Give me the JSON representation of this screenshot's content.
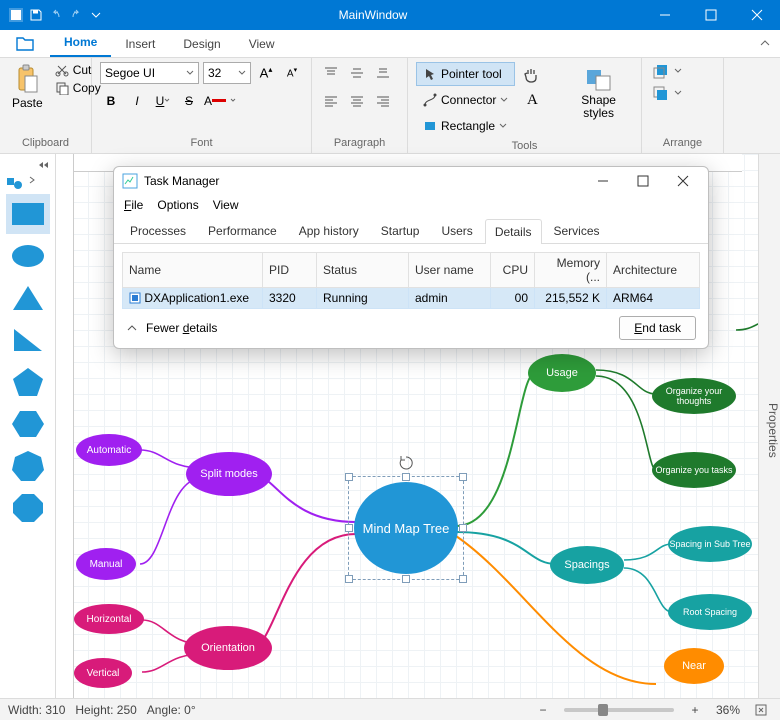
{
  "window": {
    "title": "MainWindow"
  },
  "ribbon": {
    "tabs": [
      "Home",
      "Insert",
      "Design",
      "View"
    ],
    "activeTab": 0,
    "clipboard": {
      "paste": "Paste",
      "cut": "Cut",
      "copy": "Copy",
      "label": "Clipboard"
    },
    "font": {
      "family": "Segoe UI",
      "size": "32",
      "label": "Font"
    },
    "paragraph": {
      "label": "Paragraph"
    },
    "tools": {
      "pointer": "Pointer tool",
      "connector": "Connector",
      "rectangle": "Rectangle",
      "shapeStyles": "Shape styles",
      "label": "Tools"
    },
    "arrange": {
      "label": "Arrange"
    }
  },
  "properties_label": "Properties",
  "status": {
    "width_label": "Width:",
    "width": "310",
    "height_label": "Height:",
    "height": "250",
    "angle_label": "Angle:",
    "angle": "0°",
    "zoom": "36%"
  },
  "mindmap": {
    "center": "Mind Map Tree",
    "usage": "Usage",
    "usage_c1": "Organize your thoughts",
    "usage_c2": "Organize you tasks",
    "spacings": "Spacings",
    "sp_c1": "Spacing in Sub Tree",
    "sp_c2": "Root Spacing",
    "near": "Near",
    "split": "Split modes",
    "auto": "Automatic",
    "manual": "Manual",
    "orientation": "Orientation",
    "horiz": "Horizontal",
    "vert": "Vertical"
  },
  "taskmgr": {
    "title": "Task Manager",
    "menu": {
      "file": "File",
      "options": "Options",
      "view": "View"
    },
    "tabs": [
      "Processes",
      "Performance",
      "App history",
      "Startup",
      "Users",
      "Details",
      "Services"
    ],
    "activeTab": 5,
    "columns": [
      "Name",
      "PID",
      "Status",
      "User name",
      "CPU",
      "Memory (...",
      "Architecture"
    ],
    "row": {
      "name": "DXApplication1.exe",
      "pid": "3320",
      "status": "Running",
      "user": "admin",
      "cpu": "00",
      "mem": "215,552 K",
      "arch": "ARM64"
    },
    "fewer": "Fewer details",
    "fewer_u": "d",
    "endtask": "End task",
    "endtask_u": "E"
  }
}
